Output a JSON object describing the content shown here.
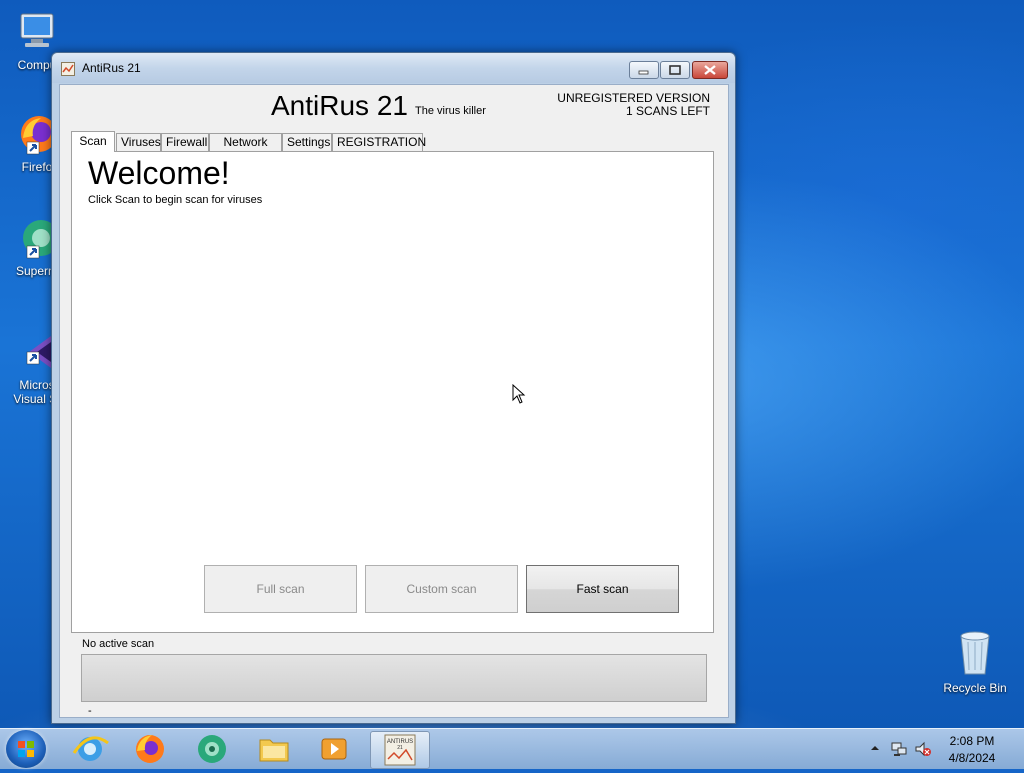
{
  "desktop": {
    "icons": [
      {
        "label": "Compu"
      },
      {
        "label": "Firefo"
      },
      {
        "label": "Superm"
      },
      {
        "label": "Micros",
        "label2": "Visual St"
      }
    ],
    "recycle_bin": "Recycle Bin"
  },
  "window": {
    "title": "AntiRus 21"
  },
  "app": {
    "name": "AntiRus 21",
    "tagline": "The virus killer",
    "registration_status": "UNREGISTERED VERSION",
    "scans_left": "1 SCANS LEFT"
  },
  "tabs": [
    {
      "label": "Scan",
      "active": true
    },
    {
      "label": "Viruses"
    },
    {
      "label": "Firewall"
    },
    {
      "label": "Network filter"
    },
    {
      "label": "Settings"
    },
    {
      "label": "REGISTRATION"
    }
  ],
  "scan_panel": {
    "heading": "Welcome!",
    "subtitle": "Click Scan to begin scan for viruses",
    "buttons": {
      "full": "Full scan",
      "custom": "Custom scan",
      "fast": "Fast scan"
    },
    "status": "No active scan",
    "progress_percent": 0,
    "footer": "-"
  },
  "taskbar": {
    "apps": [
      "internet-explorer",
      "firefox",
      "supermium",
      "file-explorer",
      "media-player",
      "antirus-21"
    ],
    "active_app_label_1": "ANTIRUS",
    "active_app_label_2": "21",
    "time": "2:08 PM",
    "date": "4/8/2024"
  }
}
